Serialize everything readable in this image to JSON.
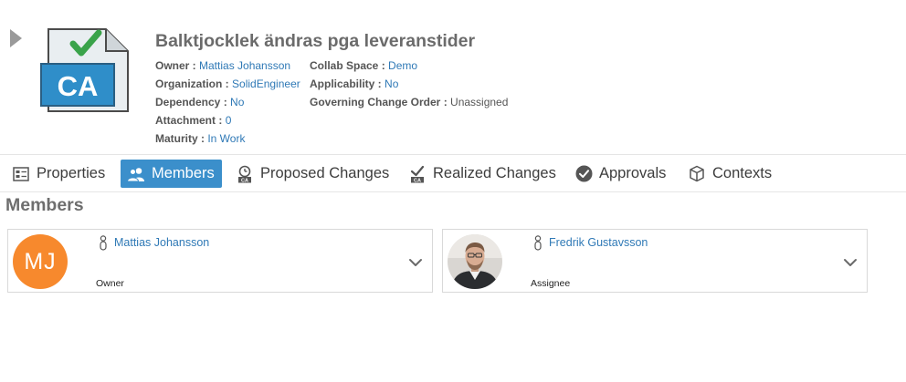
{
  "header": {
    "title": "Balktjocklek ändras pga leveranstider",
    "icon_text": "CA",
    "properties_col1": [
      {
        "key": "Owner :",
        "value": "Mattias Johansson",
        "link": true
      },
      {
        "key": "Organization :",
        "value": "SolidEngineer",
        "link": true
      },
      {
        "key": "Dependency :",
        "value": "No",
        "link": true
      },
      {
        "key": "Attachment :",
        "value": "0",
        "link": true
      },
      {
        "key": "Maturity :",
        "value": " In Work",
        "link": true
      }
    ],
    "properties_col2": [
      {
        "key": "Collab Space :",
        "value": "Demo",
        "link": true
      },
      {
        "key": "Applicability :",
        "value": "No",
        "link": true
      },
      {
        "key": "Governing Change Order :",
        "value": "Unassigned",
        "link": false
      }
    ]
  },
  "tabs": [
    {
      "label": "Properties",
      "icon": "properties-icon",
      "active": false
    },
    {
      "label": "Members",
      "icon": "members-icon",
      "active": true
    },
    {
      "label": "Proposed Changes",
      "icon": "proposed-changes-icon",
      "active": false
    },
    {
      "label": "Realized Changes",
      "icon": "realized-changes-icon",
      "active": false
    },
    {
      "label": "Approvals",
      "icon": "approvals-icon",
      "active": false
    },
    {
      "label": "Contexts",
      "icon": "contexts-icon",
      "active": false
    }
  ],
  "members_section": {
    "title": "Members",
    "cards": [
      {
        "name": "Mattias Johansson",
        "initials": "MJ",
        "role": "Owner",
        "avatar_type": "initials",
        "avatar_color": "#f7892d"
      },
      {
        "name": "Fredrik Gustavsson",
        "initials": "",
        "role": "Assignee",
        "avatar_type": "photo"
      }
    ]
  },
  "colors": {
    "accent": "#3b8fcb",
    "link": "#2f79b6",
    "avatar_orange": "#f7892d"
  }
}
